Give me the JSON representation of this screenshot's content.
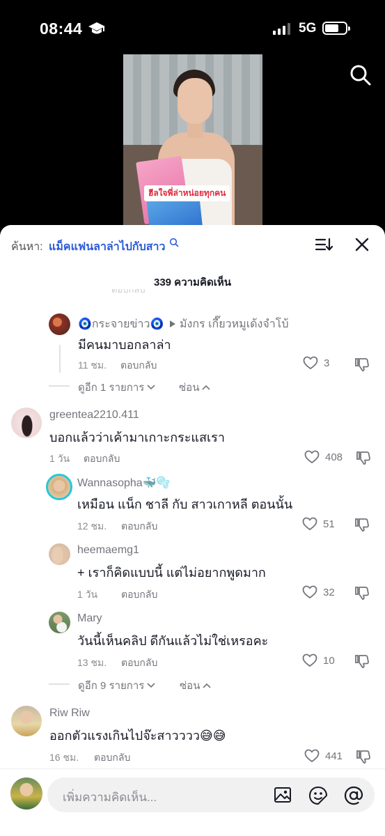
{
  "status": {
    "time": "08:44",
    "network": "5G"
  },
  "video": {
    "caption": "ฮีลใจพี่ล่าหน่อยทุกคน"
  },
  "header": {
    "search_prefix": "ค้นหา:",
    "search_query": "แม็คแฟนลาล่าไปกับสาว",
    "comment_count": "339 ความคิดเห็น"
  },
  "faded_top": {
    "left": "ตอบกลับ"
  },
  "comments": [
    {
      "user": "🧿กระจายข่าว🧿",
      "reply_to": "มังกร เกี๊ยวหมูเด้งจำโบ้",
      "text": "มีคนมาบอกลาล่า",
      "time": "11 ชม.",
      "reply_label": "ตอบกลับ",
      "likes": "3"
    },
    {
      "user": "greentea2210.411",
      "text": "บอกแล้วว่าเค้ามาเกาะกระแสเรา",
      "time": "1 วัน",
      "reply_label": "ตอบกลับ",
      "likes": "408"
    },
    {
      "user": "Wannasopha🐳🫧",
      "text": "เหมือน แน็ก ชาลี กับ สาวเกาหลี ตอนนั้น",
      "time": "12 ชม.",
      "reply_label": "ตอบกลับ",
      "likes": "51"
    },
    {
      "user": "heemaemg1",
      "text": "+ เราก็คิดแบบนี้ แต่ไม่อยากพูดมาก",
      "time": "1 วัน",
      "reply_label": "ตอบกลับ",
      "likes": "32"
    },
    {
      "user": "Mary",
      "text": "วันนี้เห็นคลิป ดีกันแล้วไม่ใช่เหรอคะ",
      "time": "13 ชม.",
      "reply_label": "ตอบกลับ",
      "likes": "10"
    },
    {
      "user": "Riw Riw",
      "text": "ออกตัวแรงเกินไปจ๊ะสาวววว😅😅",
      "time": "16 ชม.",
      "reply_label": "ตอบกลับ",
      "likes": "441"
    }
  ],
  "more_replies": [
    {
      "label": "ดูอีก 1 รายการ",
      "hide": "ซ่อน"
    },
    {
      "label": "ดูอีก 9 รายการ",
      "hide": "ซ่อน"
    }
  ],
  "composer": {
    "placeholder": "เพิ่มความคิดเห็น..."
  },
  "colors": {
    "accent": "#2b5bd7",
    "text": "#161823",
    "muted": "#73757c",
    "caption": "#e0293b"
  }
}
